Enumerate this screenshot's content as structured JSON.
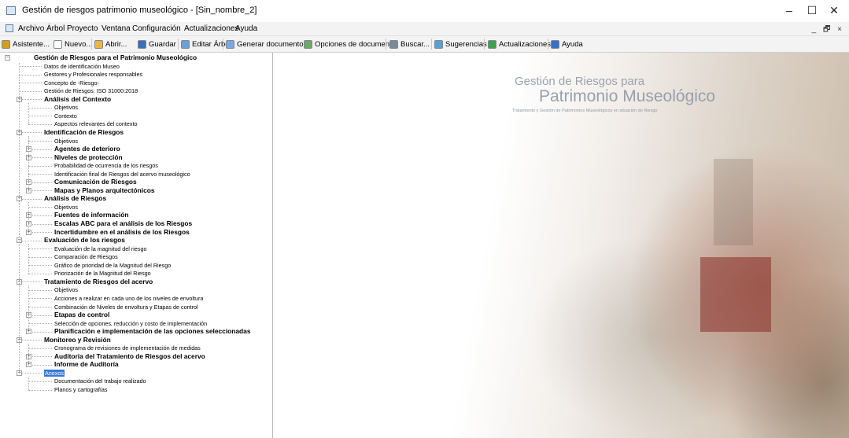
{
  "window": {
    "title": "Gestión de riesgos patrimonio museológico - [Sin_nombre_2]",
    "minimize": "–",
    "maximize": "☐",
    "close": "✕"
  },
  "menu": {
    "items": [
      "Archivo",
      "Árbol",
      "Proyecto",
      "Ventana",
      "Configuración",
      "Actualizaciones",
      "Ayuda"
    ],
    "mdi_controls": "_ 🗗 ×"
  },
  "toolbar": {
    "buttons": [
      {
        "label": "Asistente...",
        "icon": "wand-icon",
        "color": "#d4a017"
      },
      {
        "label": "Nuevo...",
        "icon": "new-document-icon",
        "color": "#ffffff"
      },
      {
        "label": "Abrir...",
        "icon": "open-folder-icon",
        "color": "#e8b83a"
      },
      {
        "label": "Guardar",
        "icon": "save-icon",
        "color": "#3b6fb6"
      },
      {
        "label": "Editar Árbol",
        "icon": "tree-edit-icon",
        "color": "#6a9fd8"
      },
      {
        "label": "Generar documento...",
        "icon": "generate-document-icon",
        "color": "#7fa7d9"
      },
      {
        "label": "Opciones de documento",
        "icon": "document-options-icon",
        "color": "#6fa86a"
      },
      {
        "label": "Buscar...",
        "icon": "binoculars-icon",
        "color": "#7a8a99"
      },
      {
        "label": "Sugerencias",
        "icon": "suggestions-icon",
        "color": "#5e9fd0"
      },
      {
        "label": "Actualizaciones",
        "icon": "updates-icon",
        "color": "#3ea24a"
      },
      {
        "label": "Ayuda",
        "icon": "help-icon",
        "color": "#3c6fc4"
      }
    ]
  },
  "tree": {
    "nodes": [
      {
        "label": "Gestión de Riesgos para el Patrimonio Museológico",
        "level": 0,
        "bold": true,
        "expander": "−"
      },
      {
        "label": "Datos de identificación Museo",
        "level": 1
      },
      {
        "label": "Gestores y Profesionales responsables",
        "level": 1
      },
      {
        "label": "Concepto de -Riesgo-",
        "level": 1
      },
      {
        "label": "Gestión de Riesgos: ISO 31000:2018",
        "level": 1
      },
      {
        "label": "Análisis del Contexto",
        "level": 1,
        "bold": true,
        "expander": "−"
      },
      {
        "label": "Objetivos",
        "level": 2
      },
      {
        "label": "Contexto",
        "level": 2
      },
      {
        "label": "Aspectos relevantes del contexto",
        "level": 2
      },
      {
        "label": "Identificación de Riesgos",
        "level": 1,
        "bold": true,
        "expander": "−"
      },
      {
        "label": "Objetivos",
        "level": 2
      },
      {
        "label": "Agentes de deterioro",
        "level": 2,
        "bold": true,
        "expander": "+"
      },
      {
        "label": "Niveles de protección",
        "level": 2,
        "bold": true,
        "expander": "+"
      },
      {
        "label": "Probabilidad de ocurrencia de los riesgos",
        "level": 2
      },
      {
        "label": "Identificación final de Riesgos del acervo museológico",
        "level": 2
      },
      {
        "label": "Comunicación de Riesgos",
        "level": 2,
        "bold": true,
        "expander": "+"
      },
      {
        "label": "Mapas y Planos arquitectónicos",
        "level": 2,
        "bold": true,
        "expander": "+"
      },
      {
        "label": "Análisis de Riesgos",
        "level": 1,
        "bold": true,
        "expander": "−"
      },
      {
        "label": "Objetivos",
        "level": 2
      },
      {
        "label": "Fuentes de información",
        "level": 2,
        "bold": true,
        "expander": "+"
      },
      {
        "label": "Escalas ABC para el análisis de los Riesgos",
        "level": 2,
        "bold": true,
        "expander": "+"
      },
      {
        "label": "Incertidumbre en el análisis de los Riesgos",
        "level": 2,
        "bold": true,
        "expander": "+"
      },
      {
        "label": "Evaluación de los riesgos",
        "level": 1,
        "bold": true,
        "expander": "−"
      },
      {
        "label": "Evaluación de la magnitud del riesgo",
        "level": 2
      },
      {
        "label": "Comparación de Riesgos",
        "level": 2
      },
      {
        "label": "Gráfico de prioridad de la Magnitud del Riesgo",
        "level": 2
      },
      {
        "label": "Priorización de la Magnitud del Riesgo",
        "level": 2
      },
      {
        "label": "Tratamiento de Riesgos del acervo",
        "level": 1,
        "bold": true,
        "expander": "−"
      },
      {
        "label": "Objetivos",
        "level": 2
      },
      {
        "label": "Acciones a realizar en cada uno de los niveles de envoltura",
        "level": 2
      },
      {
        "label": "Combinación de Niveles de envoltura y Etapas de control",
        "level": 2
      },
      {
        "label": "Etapas de control",
        "level": 2,
        "bold": true,
        "expander": "+"
      },
      {
        "label": "Selección de opciones, reducción y costo de implementación",
        "level": 2
      },
      {
        "label": "Planificación e implementación de las opciones seleccionadas",
        "level": 2,
        "bold": true,
        "expander": "+"
      },
      {
        "label": "Monitoreo y Revisión",
        "level": 1,
        "bold": true,
        "expander": "−"
      },
      {
        "label": "Cronograma de revisiones de implementación de medidas",
        "level": 2
      },
      {
        "label": "Auditoría del Tratamiento de Riesgos del acervo",
        "level": 2,
        "bold": true,
        "expander": "+"
      },
      {
        "label": "Informe de Auditoría",
        "level": 2,
        "bold": true,
        "expander": "+"
      },
      {
        "label": "Anexos",
        "level": 1,
        "expander": "−",
        "selected": true
      },
      {
        "label": "Documentación del trabajo realizado",
        "level": 2
      },
      {
        "label": "Planos y cartografías",
        "level": 2
      }
    ]
  },
  "document": {
    "heading_small": "Gestión de Riesgos para",
    "heading_large": "Patrimonio Museológico",
    "subtitle": "Tratamiento y Gestión de Patrimonios Museológicos en situación de Riesgo"
  }
}
